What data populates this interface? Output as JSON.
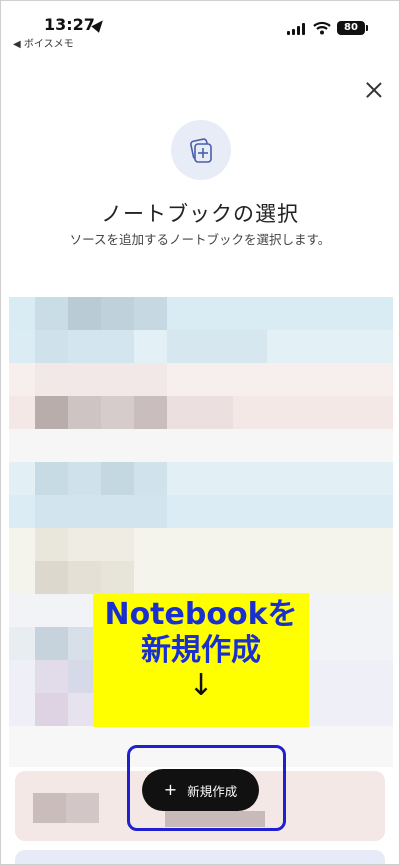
{
  "status_bar": {
    "time": "13:27",
    "back_app": "◀ ボイスメモ",
    "battery": "80",
    "icons": [
      "location-icon",
      "signal-icon",
      "wifi-icon",
      "battery-icon"
    ]
  },
  "dialog": {
    "close_icon": "close-icon",
    "header_icon": "notebook-add-icon",
    "title": "ノートブックの選択",
    "subtitle": "ソースを追加するノートブックを選択します。"
  },
  "annotation": {
    "line1": "Notebookを",
    "line2": "新規作成",
    "arrow": "↓"
  },
  "new_button": {
    "plus": "+",
    "label": "新規作成"
  },
  "colors": {
    "annotation_bg": "#ffff00",
    "annotation_text": "#1a2fd0",
    "highlight": "#2020d0",
    "button_bg": "#111111"
  }
}
